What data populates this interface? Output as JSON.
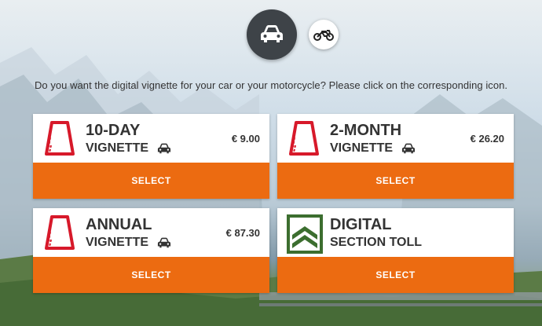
{
  "vehicle_selector": {
    "car_icon": "car-icon",
    "motorcycle_icon": "motorcycle-icon"
  },
  "question": "Do you want the digital vignette for your car or your motorcycle? Please click on the corresponding icon.",
  "cards": [
    {
      "line1": "10-DAY",
      "line2": "VIGNETTE",
      "price": "€ 9.00",
      "button": "SELECT",
      "icon": "vignette-sticker-icon"
    },
    {
      "line1": "2-MONTH",
      "line2": "VIGNETTE",
      "price": "€ 26.20",
      "button": "SELECT",
      "icon": "vignette-sticker-icon"
    },
    {
      "line1": "ANNUAL",
      "line2": "VIGNETTE",
      "price": "€ 87.30",
      "button": "SELECT",
      "icon": "vignette-sticker-icon"
    },
    {
      "line1": "DIGITAL",
      "line2": "SECTION TOLL",
      "price": "",
      "button": "SELECT",
      "icon": "section-toll-chevron-icon"
    }
  ],
  "colors": {
    "accent": "#ec6b11",
    "vignette_red": "#d7192a",
    "toll_green": "#3c6e2f",
    "dark_circle": "#3e4348"
  }
}
